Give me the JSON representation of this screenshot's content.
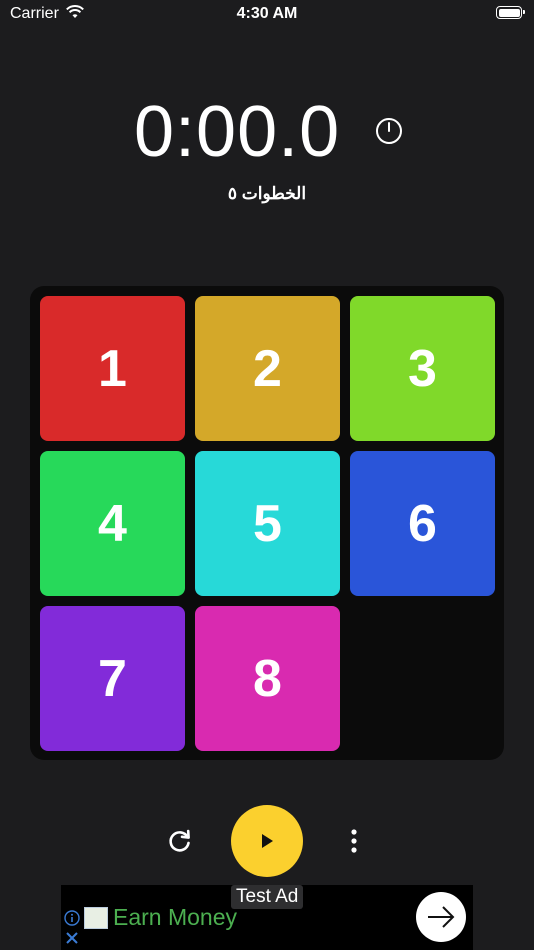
{
  "status_bar": {
    "carrier": "Carrier",
    "time": "4:30 AM"
  },
  "timer": {
    "value": "0:00.0"
  },
  "moves": {
    "label": "الخطوات ٥"
  },
  "board": {
    "tiles": [
      {
        "number": "1",
        "color": "#d92a2a"
      },
      {
        "number": "2",
        "color": "#d4a829"
      },
      {
        "number": "3",
        "color": "#80d92a"
      },
      {
        "number": "4",
        "color": "#27d95a"
      },
      {
        "number": "5",
        "color": "#27d9d8"
      },
      {
        "number": "6",
        "color": "#2a55d9"
      },
      {
        "number": "7",
        "color": "#822bd9"
      },
      {
        "number": "8",
        "color": "#d92ab0"
      }
    ],
    "empty_slot": "bottom-right"
  },
  "controls": {
    "refresh_icon": "refresh-icon",
    "play_icon": "play-icon",
    "more_icon": "more-vertical-icon",
    "play_color": "#fbd02e"
  },
  "ad": {
    "label": "Test Ad",
    "text": "Earn Money",
    "cta_icon": "arrow-right-icon",
    "text_color": "#4caf50"
  }
}
